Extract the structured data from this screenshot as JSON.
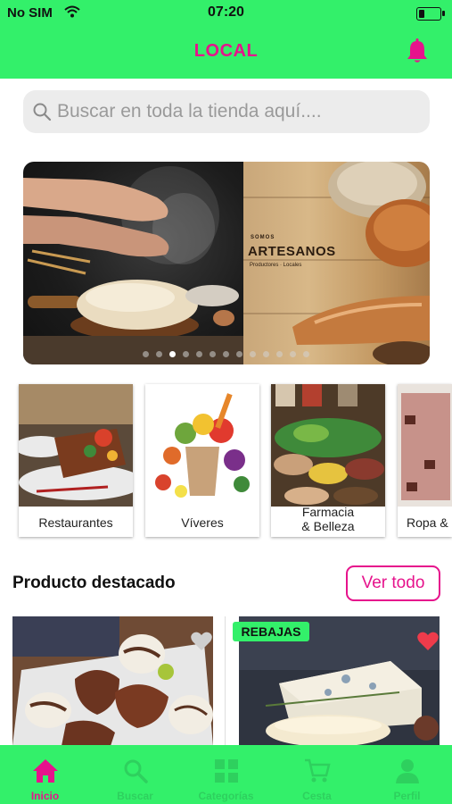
{
  "status_bar": {
    "carrier": "No SIM",
    "time": "07:20"
  },
  "header": {
    "title": "LOCAL"
  },
  "search": {
    "placeholder": "Buscar en toda la tienda aquí...."
  },
  "banner": {
    "brand_small": "SOMOS",
    "brand": "ARTESANOS",
    "subtitle": "Productores · Locales",
    "slide_count": 13,
    "active_slide": 3
  },
  "categories": [
    {
      "label": "Restaurantes"
    },
    {
      "label": "Víveres"
    },
    {
      "label": "Farmacia\n& Belleza"
    },
    {
      "label": "Ropa &"
    }
  ],
  "featured": {
    "title": "Producto destacado",
    "see_all": "Ver todo",
    "products": [
      {
        "badge": "",
        "favorite": false
      },
      {
        "badge": "REBAJAS",
        "favorite": true
      }
    ]
  },
  "tabbar": {
    "items": [
      {
        "label": "Inicio",
        "icon": "home-icon",
        "active": true
      },
      {
        "label": "Buscar",
        "icon": "search-icon",
        "active": false
      },
      {
        "label": "Categorías",
        "icon": "categories-icon",
        "active": false
      },
      {
        "label": "Cesta",
        "icon": "cart-icon",
        "active": false
      },
      {
        "label": "Perfil",
        "icon": "profile-icon",
        "active": false
      }
    ]
  },
  "colors": {
    "accent": "#33f06a",
    "brand": "#e6138c",
    "heart_active": "#ee3b4b",
    "heart_inactive": "#cfcfcf"
  }
}
